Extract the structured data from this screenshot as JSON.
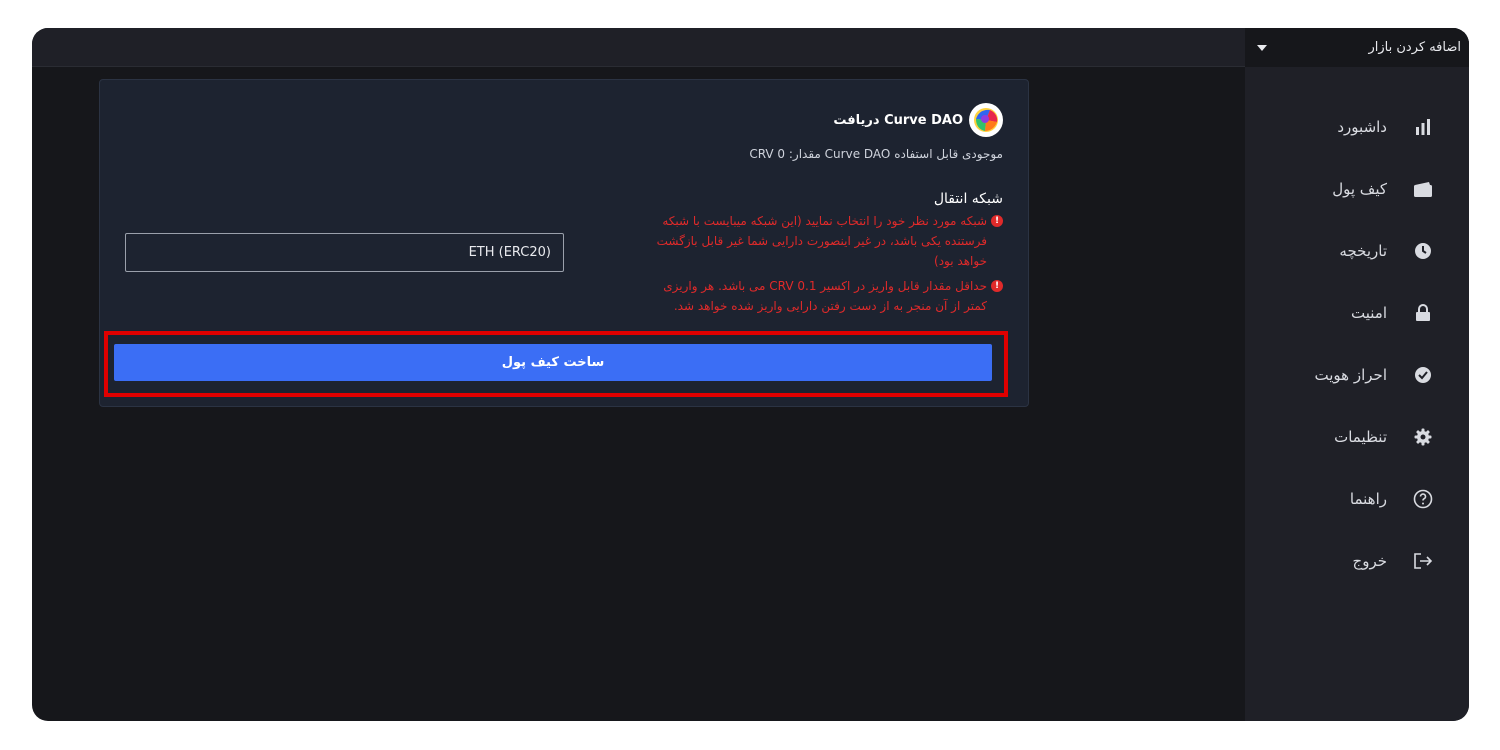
{
  "market": {
    "label": "اضافه کردن بازار"
  },
  "sidebar": {
    "items": [
      {
        "label": "داشبورد",
        "icon": "bar-chart-icon"
      },
      {
        "label": "کیف پول",
        "icon": "wallet-icon"
      },
      {
        "label": "تاریخچه",
        "icon": "clock-icon"
      },
      {
        "label": "امنیت",
        "icon": "lock-icon"
      },
      {
        "label": "احراز هویت",
        "icon": "check-badge-icon"
      },
      {
        "label": "تنظیمات",
        "icon": "gear-icon"
      },
      {
        "label": "راهنما",
        "icon": "help-icon"
      },
      {
        "label": "خروج",
        "icon": "logout-icon"
      }
    ]
  },
  "deposit": {
    "title": "دریافت Curve DAO",
    "balance": "موجودی قابل استفاده Curve DAO مقدار: 0 CRV",
    "network_title": "شبکه انتقال",
    "network_value": "ETH (ERC20)",
    "warning_network": "شبکه مورد نظر خود را انتخاب نمایید (این شبکه میبایست با شبکه فرستنده یکی باشد، در غیر اینصورت دارایی شما غیر قابل بازگشت خواهد بود)",
    "warning_min": "حداقل مقدار قابل واریز در اکسیر CRV 0.1 می باشد. هر واریزی کمتر از آن منجر به از دست رفتن دارایی واریز شده خواهد شد.",
    "create_button": "ساخت کیف پول"
  },
  "colors": {
    "accent": "#3b6ef5",
    "warning": "#e02a2a",
    "highlight": "#e00000"
  }
}
